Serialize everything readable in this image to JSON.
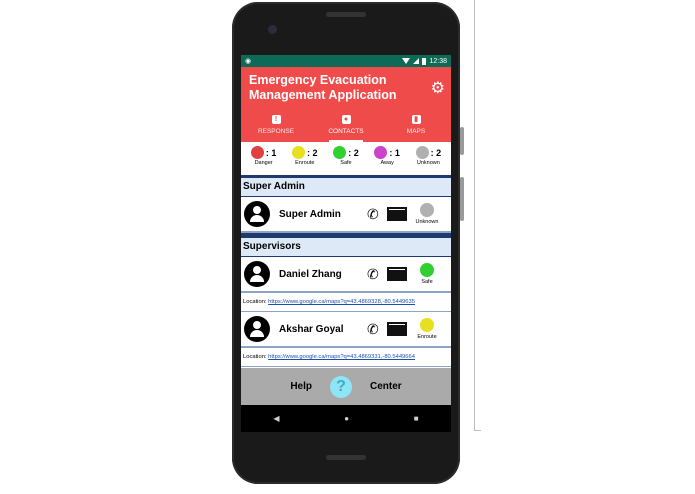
{
  "status_bar": {
    "time": "12:38"
  },
  "app": {
    "title": "Emergency Evacuation Management Application"
  },
  "tabs": [
    {
      "label": "RESPONSE",
      "icon": "alert-icon",
      "active": false
    },
    {
      "label": "CONTACTS",
      "icon": "contacts-icon",
      "active": true
    },
    {
      "label": "MAPS",
      "icon": "map-icon",
      "active": false
    }
  ],
  "status_counts": [
    {
      "label": "Danger",
      "count": ": 1",
      "color": "#e04040"
    },
    {
      "label": "Enroute",
      "count": ": 2",
      "color": "#e6e020"
    },
    {
      "label": "Safe",
      "count": ": 2",
      "color": "#2fd02f"
    },
    {
      "label": "Away",
      "count": ": 1",
      "color": "#cc44cc"
    },
    {
      "label": "Unknown",
      "count": ": 2",
      "color": "#b0b0b0"
    }
  ],
  "sections": {
    "super_admin": {
      "title": "Super Admin",
      "contact": {
        "name": "Super Admin",
        "status": "Unknown",
        "status_color": "#b0b0b0"
      }
    },
    "supervisors": {
      "title": "Supervisors",
      "contacts": [
        {
          "name": "Daniel Zhang",
          "status": "Safe",
          "status_color": "#2fd02f",
          "location_label": "Location:",
          "location_url": "https://www.google.ca/maps?q=43.4869328,-80.5449635"
        },
        {
          "name": "Akshar Goyal",
          "status": "Enroute",
          "status_color": "#e6e020",
          "location_label": "Location:",
          "location_url": "https://www.google.ca/maps?q=43.4869331,-80.5449664"
        }
      ]
    }
  },
  "bottom_bar": {
    "help_label": "Help",
    "center_label": "Center",
    "help_symbol": "?"
  },
  "nav": {
    "back": "◀",
    "home": "●",
    "recent": "■"
  }
}
